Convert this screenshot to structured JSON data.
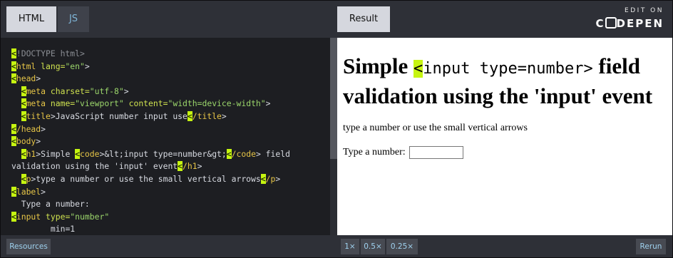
{
  "tabs": {
    "html": "HTML",
    "js": "JS",
    "result": "Result"
  },
  "brand": {
    "edit_on": "EDIT ON",
    "name_pre": "C",
    "name_post": "DEPEN"
  },
  "code": {
    "l1_doctype": "!DOCTYPE html",
    "l2_html": "html",
    "l2_attr": " lang=",
    "l2_val": "\"en\"",
    "l3_head": "head",
    "l4_meta": "meta",
    "l4_attr": " charset=",
    "l4_val": "\"utf-8\"",
    "l5_meta": "meta",
    "l5_attr": " name=",
    "l5_val": "\"viewport\"",
    "l5_attr2": " content=",
    "l5_val2": "\"width=device-width\"",
    "l6_title": "title",
    "l6_text": "JavaScript number input use",
    "l6_close": "/title",
    "l7_close": "/head",
    "l8_body": "body",
    "l9_h1": "h1",
    "l9_text1": "Simple ",
    "l9_code": "code",
    "l9_text2": "&lt;input type=number&gt;",
    "l9_close_code": "/code",
    "l9_text3": " field",
    "l10_text": "validation using the 'input' event",
    "l10_close": "/h1",
    "l11_p": "p",
    "l11_text": "type a number or use the small vertical arrows",
    "l11_close": "/p",
    "l12_label": "label",
    "l13_text": "Type a number:",
    "l14_input": "input",
    "l14_attr": " type=",
    "l14_val": "\"number\"",
    "l15_text": "min=1"
  },
  "result": {
    "heading_pre": "Simple ",
    "heading_lt": "<",
    "heading_code": "input type=number>",
    "heading_post": " field validation using the 'input' event",
    "paragraph": "type a number or use the small vertical arrows",
    "label": "Type a number:",
    "input_value": ""
  },
  "bottom": {
    "resources": "Resources",
    "zoom_1x": "1×",
    "zoom_05x": "0.5×",
    "zoom_025x": "0.25×",
    "rerun": "Rerun"
  },
  "colors": {
    "highlight": "#c6f511",
    "tag": "#e6c547",
    "attr_value": "#9bd66b",
    "js_tab": "#7fb6d9"
  }
}
